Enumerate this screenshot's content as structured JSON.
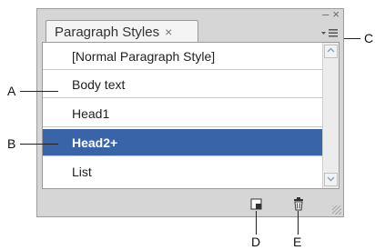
{
  "panel": {
    "window_controls": {
      "minimize": "–",
      "close": "×"
    },
    "tab": {
      "label": "Paragraph Styles",
      "close": "×"
    },
    "menu_icon": "panel-menu-icon"
  },
  "styles": [
    {
      "label": "[Normal Paragraph Style]",
      "selected": false
    },
    {
      "label": "Body text",
      "selected": false
    },
    {
      "label": "Head1",
      "selected": false
    },
    {
      "label": "Head2+",
      "selected": true
    },
    {
      "label": "List",
      "selected": false
    }
  ],
  "bottom_bar": {
    "new_style_icon": "new-style-icon",
    "delete_style_icon": "trash-icon"
  },
  "callouts": {
    "A": "A",
    "B": "B",
    "C": "C",
    "D": "D",
    "E": "E"
  }
}
